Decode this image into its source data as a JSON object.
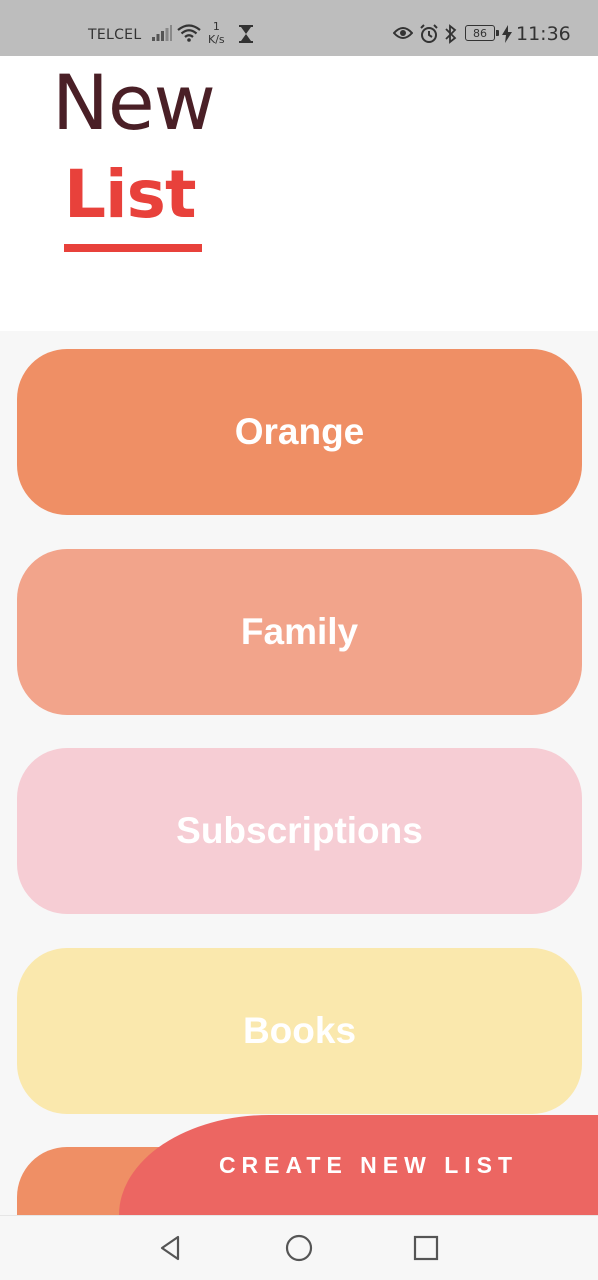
{
  "status_bar": {
    "carrier": "TELCEL",
    "net_speed_value": "1",
    "net_speed_unit": "K/s",
    "battery_level": "86",
    "time": "11:36"
  },
  "header": {
    "title_line1": "New",
    "title_line2": "List"
  },
  "lists": [
    {
      "label": "Orange",
      "color": "#ef8f65"
    },
    {
      "label": "Family",
      "color": "#f2a48b"
    },
    {
      "label": "Subscriptions",
      "color": "#f6cdd4"
    },
    {
      "label": "Books",
      "color": "#fae8ad"
    },
    {
      "label": "",
      "color": "#ef8f65"
    }
  ],
  "create_button": {
    "label": "CREATE NEW LIST",
    "color": "#ec6662"
  },
  "colors": {
    "accent": "#e8413b",
    "title_dark": "#4a1f26"
  },
  "nav_bar": {
    "icons": [
      "back-icon",
      "home-icon",
      "recent-apps-icon"
    ]
  }
}
